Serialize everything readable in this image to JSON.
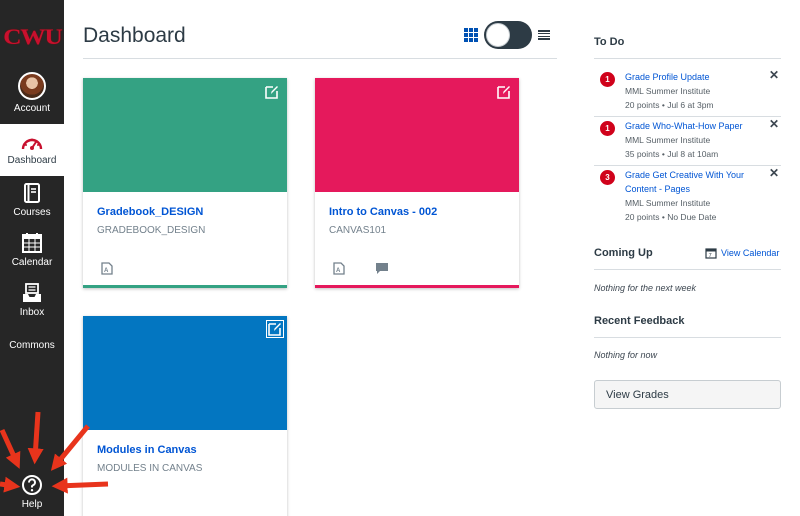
{
  "brand": {
    "logo_text": "CWU",
    "logo_color": "#c8102e"
  },
  "global_nav": {
    "items": [
      {
        "id": "account",
        "label": "Account",
        "icon": "avatar"
      },
      {
        "id": "dashboard",
        "label": "Dashboard",
        "icon": "dashboard-gauge-icon",
        "active": true
      },
      {
        "id": "courses",
        "label": "Courses",
        "icon": "courses-book-icon"
      },
      {
        "id": "calendar",
        "label": "Calendar",
        "icon": "calendar-icon"
      },
      {
        "id": "inbox",
        "label": "Inbox",
        "icon": "inbox-tray-icon"
      },
      {
        "id": "commons",
        "label": "Commons",
        "icon": ""
      },
      {
        "id": "help",
        "label": "Help",
        "icon": "help-question-icon"
      }
    ]
  },
  "header": {
    "title": "Dashboard",
    "view_mode": "card"
  },
  "cards": [
    {
      "name": "Gradebook_DESIGN",
      "code": "GRADEBOOK_DESIGN",
      "color": "#34a283",
      "actions": [
        "assignments-icon"
      ]
    },
    {
      "name": "Intro to Canvas - 002",
      "code": "CANVAS101",
      "color": "#e5195c",
      "actions": [
        "assignments-icon",
        "discussions-icon"
      ]
    },
    {
      "name": "Modules in Canvas",
      "code": "MODULES IN CANVAS",
      "color": "#0376c1",
      "actions": []
    }
  ],
  "sidebar": {
    "todo_title": "To Do",
    "todo_items": [
      {
        "badge": "1",
        "title": "Grade Profile Update",
        "course": "MML Summer Institute",
        "meta": "20 points • Jul 6 at 3pm"
      },
      {
        "badge": "1",
        "title": "Grade Who-What-How Paper",
        "course": "MML Summer Institute",
        "meta": "35 points • Jul 8 at 10am"
      },
      {
        "badge": "3",
        "title": "Grade Get Creative With Your Content - Pages",
        "course": "MML Summer Institute",
        "meta": "20 points • No Due Date"
      }
    ],
    "coming_up_title": "Coming Up",
    "view_calendar_label": "View Calendar",
    "coming_up_empty": "Nothing for the next week",
    "recent_feedback_title": "Recent Feedback",
    "recent_feedback_empty": "Nothing for now",
    "view_grades_label": "View Grades"
  },
  "colors": {
    "link": "#0055d4",
    "badge": "#d0021b",
    "nav_bg": "#262626",
    "annotation_arrow": "#e8341c"
  }
}
